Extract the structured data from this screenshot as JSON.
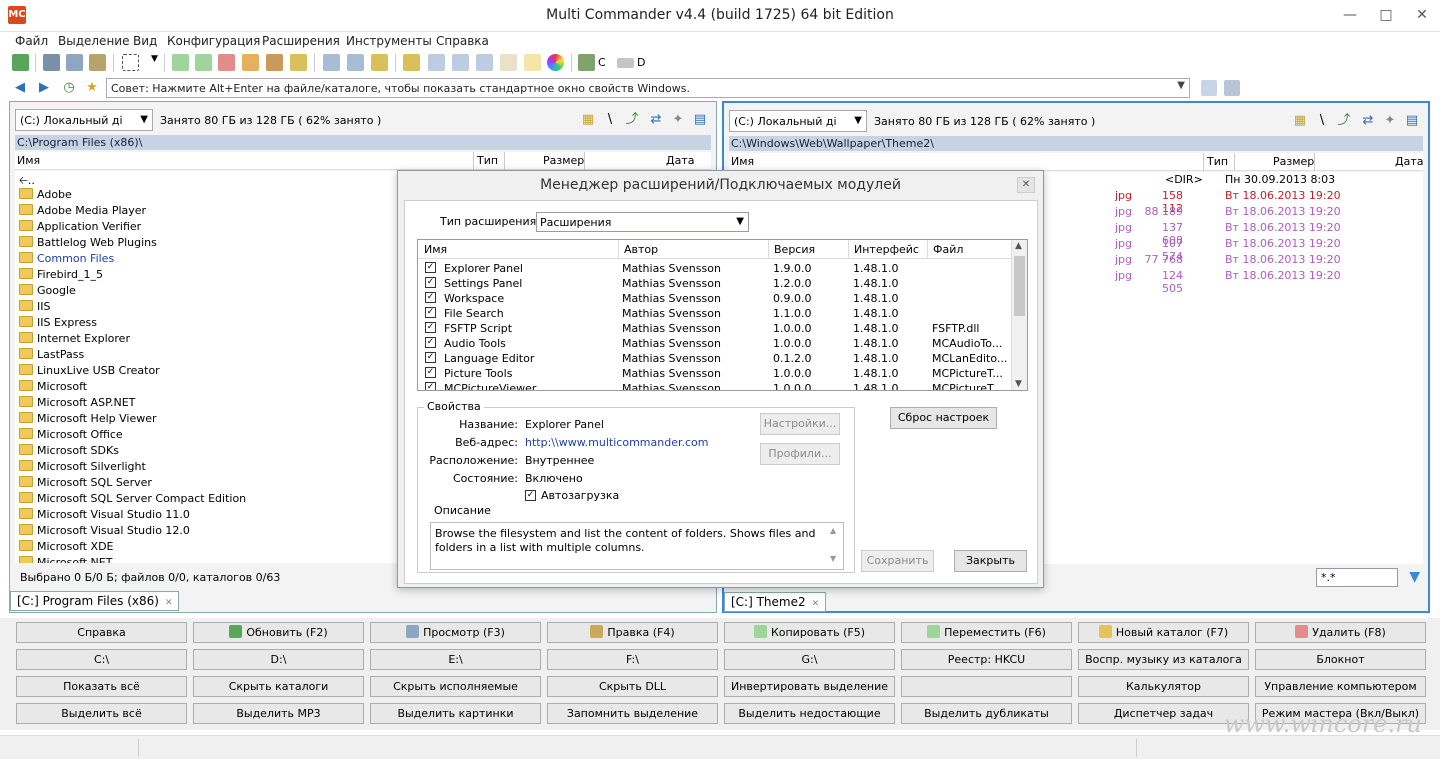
{
  "window": {
    "title": "Multi Commander v4.4 (build 1725) 64 bit Edition",
    "icon_text": "MC"
  },
  "menu": [
    "Файл",
    "Выделение",
    "Вид",
    "Конфигурация",
    "Расширения",
    "Инструменты",
    "Справка"
  ],
  "toolbar": {
    "drive_c": "C",
    "drive_d": "D"
  },
  "tip": {
    "text": "Совет: Нажмите Alt+Enter на файле/каталоге, чтобы показать стандартное окно свойств Windows."
  },
  "left_panel": {
    "drive": "(C:) Локальный ді",
    "drive_info": "Занято 80 ГБ из 128 ГБ ( 62% занято )",
    "path": "C:\\Program Files (x86)\\",
    "columns": {
      "name": "Имя",
      "type": "Тип",
      "size": "Размер",
      "date": "Дата"
    },
    "files": [
      "Adobe",
      "Adobe Media Player",
      "Application Verifier",
      "Battlelog Web Plugins",
      "Common Files",
      "Firebird_1_5",
      "Google",
      "IIS",
      "IIS Express",
      "Internet Explorer",
      "LastPass",
      "LinuxLive USB Creator",
      "Microsoft",
      "Microsoft ASP.NET",
      "Microsoft Help Viewer",
      "Microsoft Office",
      "Microsoft SDKs",
      "Microsoft Silverlight",
      "Microsoft SQL Server",
      "Microsoft SQL Server Compact Edition",
      "Microsoft Visual Studio 11.0",
      "Microsoft Visual Studio 12.0",
      "Microsoft XDE",
      "Microsoft.NET"
    ],
    "up_dir": "..",
    "status": "Выбрано 0 Б/0 Б; файлов 0/0, каталогов 0/63",
    "tab": "[C:] Program Files (x86)"
  },
  "right_panel": {
    "drive": "(C:) Локальный ді",
    "drive_info": "Занято 80 ГБ из 128 ГБ ( 62% занято )",
    "path": "C:\\Windows\\Web\\Wallpaper\\Theme2\\",
    "columns": {
      "name": "Имя",
      "type": "Тип",
      "size": "Размер",
      "date": "Дата"
    },
    "dir_row": {
      "size": "<DIR>",
      "date": "Пн 30.09.2013 8:03"
    },
    "files": [
      {
        "type": "jpg",
        "size": "158 112",
        "date": "Вт 18.06.2013 19:20",
        "color": "#c0202a"
      },
      {
        "type": "jpg",
        "size": "88 189",
        "date": "Вт 18.06.2013 19:20",
        "color": "#b05cc0"
      },
      {
        "type": "jpg",
        "size": "137 608",
        "date": "Вт 18.06.2013 19:20",
        "color": "#b05cc0"
      },
      {
        "type": "jpg",
        "size": "107 574",
        "date": "Вт 18.06.2013 19:20",
        "color": "#b05cc0"
      },
      {
        "type": "jpg",
        "size": "77 768",
        "date": "Вт 18.06.2013 19:20",
        "color": "#b05cc0"
      },
      {
        "type": "jpg",
        "size": "124 505",
        "date": "Вт 18.06.2013 19:20",
        "color": "#b05cc0"
      }
    ],
    "filter": "*.*",
    "tab": "[C:] Theme2"
  },
  "dialog": {
    "title": "Менеджер расширений/Подключаемых модулей",
    "ext_type_label": "Тип расширения :",
    "ext_type_value": "Расширения",
    "columns": {
      "name": "Имя",
      "author": "Автор",
      "version": "Версия",
      "interface": "Интерфейс",
      "file": "Файл"
    },
    "plugins": [
      {
        "name": "Explorer Panel",
        "author": "Mathias Svensson",
        "version": "1.9.0.0",
        "interface": "1.48.1.0",
        "file": ""
      },
      {
        "name": "Settings Panel",
        "author": "Mathias Svensson",
        "version": "1.2.0.0",
        "interface": "1.48.1.0",
        "file": ""
      },
      {
        "name": "Workspace",
        "author": "Mathias Svensson",
        "version": "0.9.0.0",
        "interface": "1.48.1.0",
        "file": ""
      },
      {
        "name": "File Search",
        "author": "Mathias Svensson",
        "version": "1.1.0.0",
        "interface": "1.48.1.0",
        "file": ""
      },
      {
        "name": "FSFTP Script",
        "author": "Mathias Svensson",
        "version": "1.0.0.0",
        "interface": "1.48.1.0",
        "file": "FSFTP.dll"
      },
      {
        "name": "Audio Tools",
        "author": "Mathias Svensson",
        "version": "1.0.0.0",
        "interface": "1.48.1.0",
        "file": "MCAudioTo..."
      },
      {
        "name": "Language Editor",
        "author": "Mathias Svensson",
        "version": "0.1.2.0",
        "interface": "1.48.1.0",
        "file": "MCLanEdito..."
      },
      {
        "name": "Picture Tools",
        "author": "Mathias Svensson",
        "version": "1.0.0.0",
        "interface": "1.48.1.0",
        "file": "MCPictureT..."
      },
      {
        "name": "MCPictureViewer",
        "author": "Mathias Svensson",
        "version": "1.0.0.0",
        "interface": "1.48.1.0",
        "file": "MCPictureT..."
      }
    ],
    "props_legend": "Свойства",
    "props": {
      "name_label": "Название:",
      "name_value": "Explorer Panel",
      "web_label": "Веб-адрес:",
      "web_value": "http:\\\\www.multicommander.com",
      "location_label": "Расположение:",
      "location_value": "Внутреннее",
      "state_label": "Состояние:",
      "state_value": "Включено",
      "autoload_label": "Автозагрузка"
    },
    "desc_label": "Описание",
    "description": "Browse the filesystem and list the content of folders. Shows files and folders in a list with multiple columns.",
    "btn_settings": "Настройки...",
    "btn_profiles": "Профили...",
    "btn_reset": "Сброс настроек",
    "btn_save": "Сохранить",
    "btn_close": "Закрыть"
  },
  "bottom_buttons": [
    [
      "Справка",
      "Обновить (F2)",
      "Просмотр (F3)",
      "Правка (F4)",
      "Копировать (F5)",
      "Переместить (F6)",
      "Новый каталог (F7)",
      "Удалить (F8)"
    ],
    [
      "C:\\",
      "D:\\",
      "E:\\",
      "F:\\",
      "G:\\",
      "Реестр: HKCU",
      "Воспр. музыку из каталога",
      "Блокнот"
    ],
    [
      "Показать всё",
      "Скрыть каталоги",
      "Скрыть исполняемые",
      "Скрыть DLL",
      "Инвертировать выделение",
      "",
      "Калькулятор",
      "Управление компьютером"
    ],
    [
      "Выделить всё",
      "Выделить MP3",
      "Выделить картинки",
      "Запомнить выделение",
      "Выделить недостающие",
      "Выделить дубликаты",
      "Диспетчер задач",
      "Режим мастера (Вкл/Выкл)"
    ]
  ],
  "watermark": "www.wincore.ru"
}
